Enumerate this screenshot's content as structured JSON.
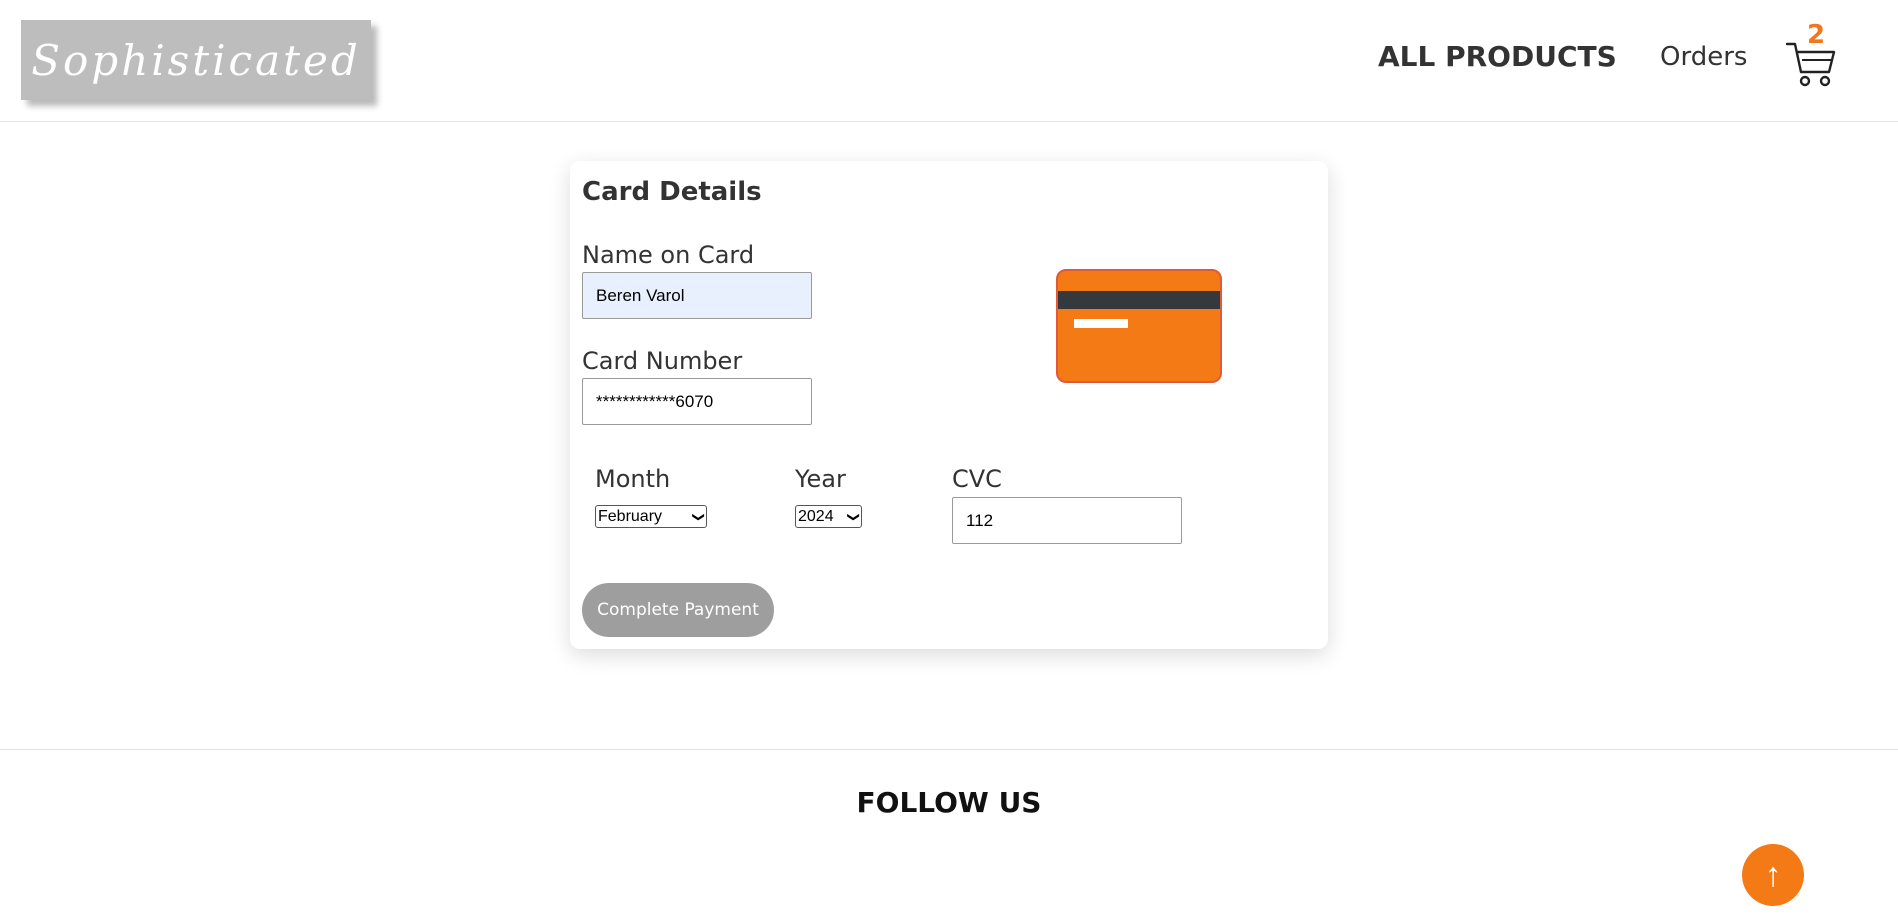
{
  "header": {
    "logo_text": "Sophisticated",
    "nav_all_products": "ALL PRODUCTS",
    "nav_orders": "Orders",
    "cart_icon": "shopping-cart-icon",
    "cart_count": "2"
  },
  "card_details": {
    "title": "Card Details",
    "name_label": "Name on Card",
    "name_value": "Beren Varol",
    "number_label": "Card Number",
    "number_value": "************6070",
    "month_label": "Month",
    "month_value": "February",
    "year_label": "Year",
    "year_value": "2024",
    "cvc_label": "CVC",
    "cvc_value": "112",
    "card_icon": "credit-card-icon",
    "pay_button": "Complete Payment"
  },
  "footer": {
    "follow_us": "FOLLOW US",
    "scroll_top_symbol": "↑"
  },
  "colors": {
    "accent": "#f47a16",
    "logo_bg": "#bdbdbd",
    "button_disabled": "#9e9e9e",
    "card_stripe": "#35383d"
  }
}
